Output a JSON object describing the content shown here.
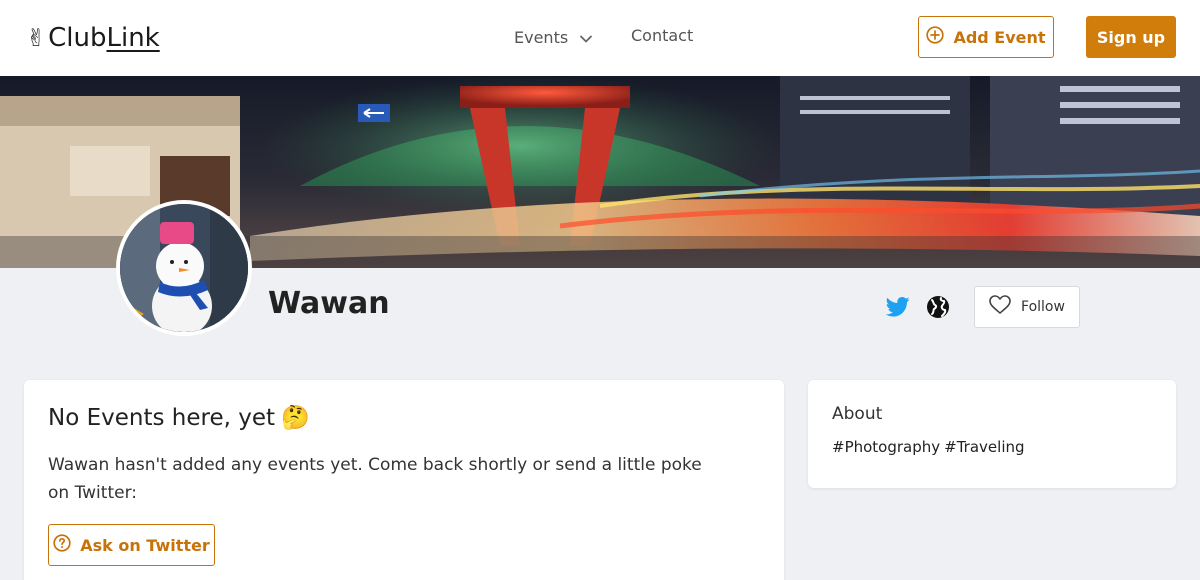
{
  "header": {
    "logo_prefix": "Club",
    "logo_suffix": "Link",
    "nav_events": "Events",
    "nav_contact": "Contact",
    "add_event": "Add Event",
    "sign_up": "Sign up"
  },
  "profile": {
    "name": "Wawan",
    "follow": "Follow"
  },
  "events_card": {
    "title": "No Events here, yet",
    "emoji": "🤔",
    "message": "Wawan hasn't added any events yet. Come back shortly or send a little poke on Twitter:",
    "ask_button": "Ask on Twitter"
  },
  "about_card": {
    "title": "About",
    "tags": [
      "#Photography",
      "#Traveling"
    ]
  },
  "colors": {
    "accent": "#d07d0c",
    "twitter": "#1da1f2",
    "page_bg": "#eef0f3"
  }
}
